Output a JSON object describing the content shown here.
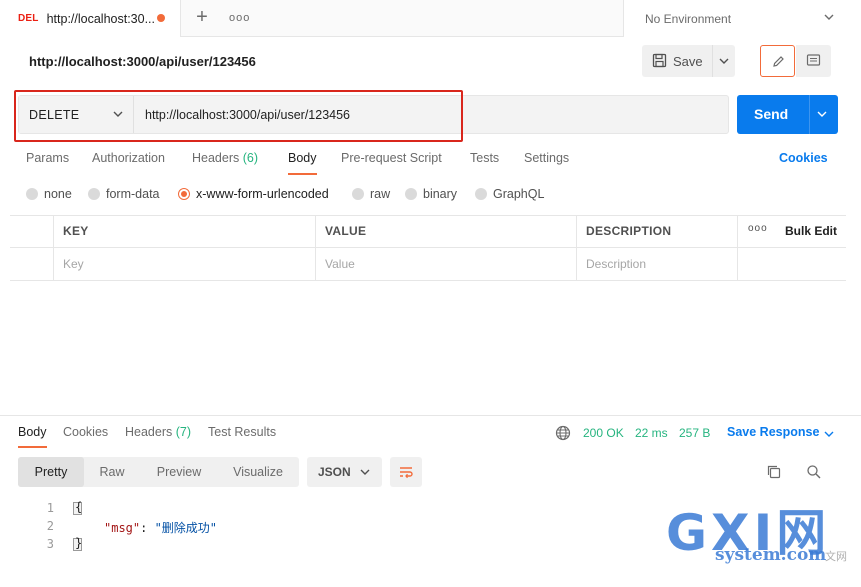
{
  "tab": {
    "method": "DEL",
    "title": "http://localhost:30..."
  },
  "environment": {
    "label": "No Environment"
  },
  "request": {
    "name": "http://localhost:3000/api/user/123456",
    "method": "DELETE",
    "url": "http://localhost:3000/api/user/123456",
    "save_label": "Save",
    "send_label": "Send"
  },
  "request_tabs": [
    {
      "label": "Params"
    },
    {
      "label": "Authorization"
    },
    {
      "label": "Headers",
      "count": "(6)"
    },
    {
      "label": "Body"
    },
    {
      "label": "Pre-request Script"
    },
    {
      "label": "Tests"
    },
    {
      "label": "Settings"
    }
  ],
  "cookies_label": "Cookies",
  "body_types": [
    {
      "label": "none"
    },
    {
      "label": "form-data"
    },
    {
      "label": "x-www-form-urlencoded"
    },
    {
      "label": "raw"
    },
    {
      "label": "binary"
    },
    {
      "label": "GraphQL"
    }
  ],
  "kv_table": {
    "headers": [
      "KEY",
      "VALUE",
      "DESCRIPTION"
    ],
    "placeholders": [
      "Key",
      "Value",
      "Description"
    ],
    "bulk_edit": "Bulk Edit"
  },
  "response": {
    "tabs": [
      {
        "label": "Body"
      },
      {
        "label": "Cookies"
      },
      {
        "label": "Headers",
        "count": "(7)"
      },
      {
        "label": "Test Results"
      }
    ],
    "status": "200 OK",
    "time": "22 ms",
    "size": "257 B",
    "save_response": "Save Response",
    "view_modes": [
      "Pretty",
      "Raw",
      "Preview",
      "Visualize"
    ],
    "format": "JSON",
    "code": {
      "line_numbers": [
        "1",
        "2",
        "3"
      ],
      "open_brace": "{",
      "key": "\"msg\"",
      "colon": ": ",
      "value": "\"删除成功\"",
      "close_brace": "}"
    }
  },
  "watermark": {
    "big": "GXI网",
    "small": "system.com",
    "tiny": "文网"
  },
  "colors": {
    "accent": "#f26b3a",
    "primary": "#097bed",
    "success": "#26b47f",
    "delete_method": "#eb2013",
    "highlight_box": "#d9261c"
  }
}
